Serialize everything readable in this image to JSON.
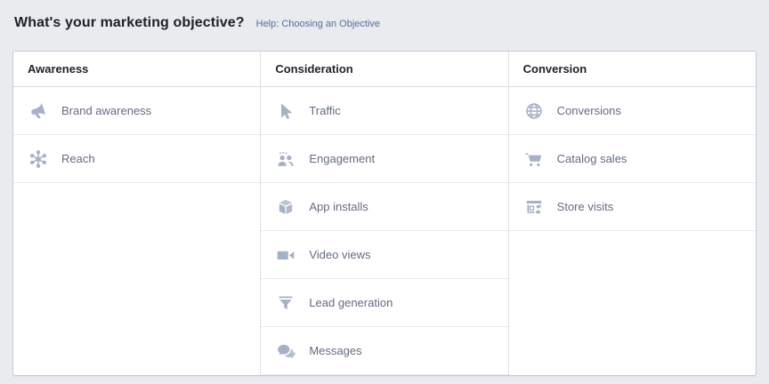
{
  "page": {
    "title": "What's your marketing objective?",
    "help_link": "Help: Choosing an Objective"
  },
  "colors": {
    "page_background": "#e9ebee",
    "card_background": "#ffffff",
    "card_border": "#c6cbd2",
    "divider": "#dddfe2",
    "header_text": "#1d2129",
    "item_text": "#636c80",
    "icon_tint": "#a6b1c7",
    "link_blue": "#5b6b9c"
  },
  "table": {
    "columns": [
      {
        "header": "Awareness",
        "items": [
          {
            "label": "Brand awareness",
            "icon": "megaphone-icon"
          },
          {
            "label": "Reach",
            "icon": "starburst-icon"
          }
        ]
      },
      {
        "header": "Consideration",
        "items": [
          {
            "label": "Traffic",
            "icon": "cursor-icon"
          },
          {
            "label": "Engagement",
            "icon": "people-icon"
          },
          {
            "label": "App installs",
            "icon": "cube-icon"
          },
          {
            "label": "Video views",
            "icon": "video-camera-icon"
          },
          {
            "label": "Lead generation",
            "icon": "funnel-icon"
          },
          {
            "label": "Messages",
            "icon": "chat-bubbles-icon"
          }
        ]
      },
      {
        "header": "Conversion",
        "items": [
          {
            "label": "Conversions",
            "icon": "globe-icon"
          },
          {
            "label": "Catalog sales",
            "icon": "shopping-cart-icon"
          },
          {
            "label": "Store visits",
            "icon": "storefront-icon"
          }
        ]
      }
    ]
  }
}
